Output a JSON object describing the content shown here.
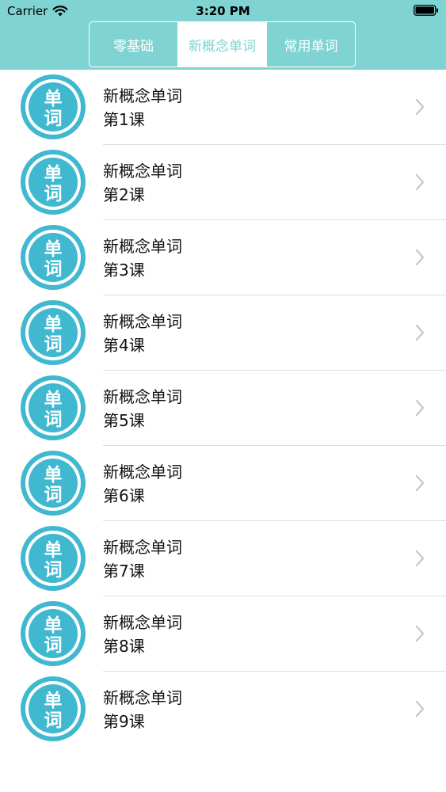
{
  "status_bar": {
    "carrier": "Carrier",
    "time": "3:20 PM"
  },
  "tabs": [
    {
      "label": "零基础",
      "active": false
    },
    {
      "label": "新概念单词",
      "active": true
    },
    {
      "label": "常用单词",
      "active": false
    }
  ],
  "avatar_text": {
    "top": "单",
    "bottom": "词"
  },
  "lessons": [
    {
      "title": "新概念单词",
      "subtitle": "第1课"
    },
    {
      "title": "新概念单词",
      "subtitle": "第2课"
    },
    {
      "title": "新概念单词",
      "subtitle": "第3课"
    },
    {
      "title": "新概念单词",
      "subtitle": "第4课"
    },
    {
      "title": "新概念单词",
      "subtitle": "第5课"
    },
    {
      "title": "新概念单词",
      "subtitle": "第6课"
    },
    {
      "title": "新概念单词",
      "subtitle": "第7课"
    },
    {
      "title": "新概念单词",
      "subtitle": "第8课"
    },
    {
      "title": "新概念单词",
      "subtitle": "第9课"
    }
  ],
  "colors": {
    "accent": "#7fd3d2",
    "avatar_ring": "#3fb8d0",
    "separator": "#dedede",
    "chevron": "#c7c7cc"
  }
}
